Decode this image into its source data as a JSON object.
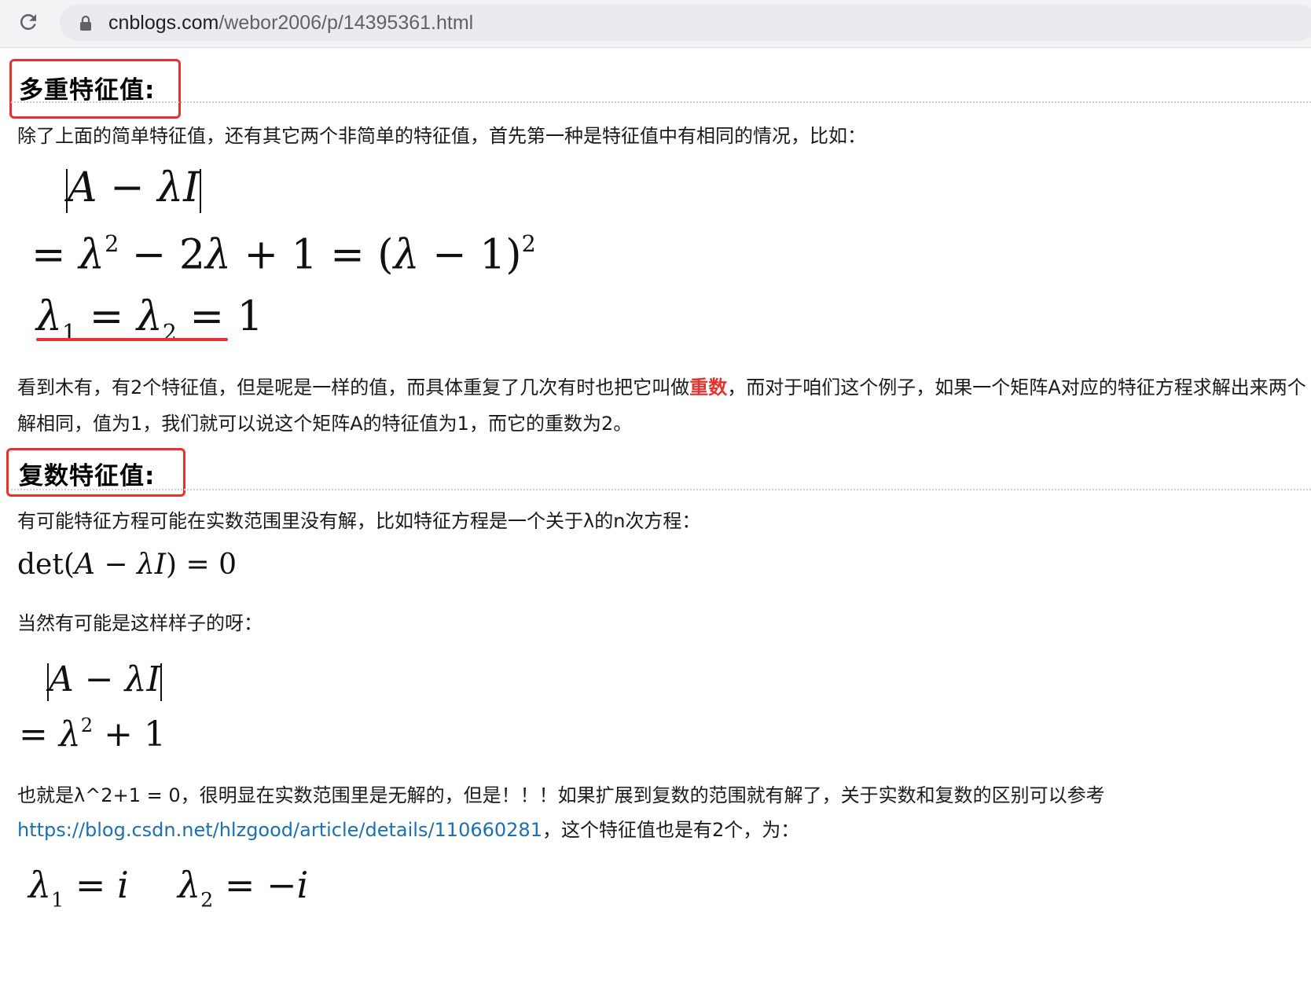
{
  "browser": {
    "url_domain": "cnblogs.com",
    "url_path": "/webor2006/p/14395361.html",
    "reload_icon": "reload-icon",
    "lock_icon": "lock-icon"
  },
  "section1": {
    "heading": "多重特征值:",
    "intro": "除了上面的简单特征值，还有其它两个非简单的特征值，首先第一种是特征值中有相同的情况，比如：",
    "eq1_lhs": "|A − λI|",
    "eq2": "= λ² − 2λ + 1 = (λ − 1)²",
    "eq3": "λ₁ = λ₂ = 1",
    "para_before": "看到木有，有2个特征值，但是呢是一样的值，而具体重复了几次有时也把它叫做",
    "para_highlight": "重数",
    "para_after": "，而对于咱们这个例子，如果一个矩阵A对应的特征方程求解出来两个解相同，值为1，我们就可以说这个矩阵A的特征值为1，而它的重数为2。"
  },
  "section2": {
    "heading": "复数特征值:",
    "intro": "有可能特征方程可能在实数范围里没有解，比如特征方程是一个关于λ的n次方程：",
    "det_eq": "det(A − λI) = 0",
    "maybe": "当然有可能是这样样子的呀：",
    "eq4": "|A − λI|",
    "eq5": "= λ² + 1",
    "line1": "也就是λ^2+1 = 0，很明显在实数范围里是无解的，但是！！！如果扩展到复数的范围就有解了，关于实数和复数的区别可以参考",
    "link": "https://blog.csdn.net/hlzgood/article/details/110660281",
    "line2_after": "，这个特征值也是有2个，为：",
    "eq6a": "λ₁ = i",
    "eq6b": "λ₂ = −i"
  },
  "colors": {
    "highlight_red": "#e8322f",
    "link_blue": "#1a6fb5",
    "urlbar_bg": "#f1f3f4"
  }
}
